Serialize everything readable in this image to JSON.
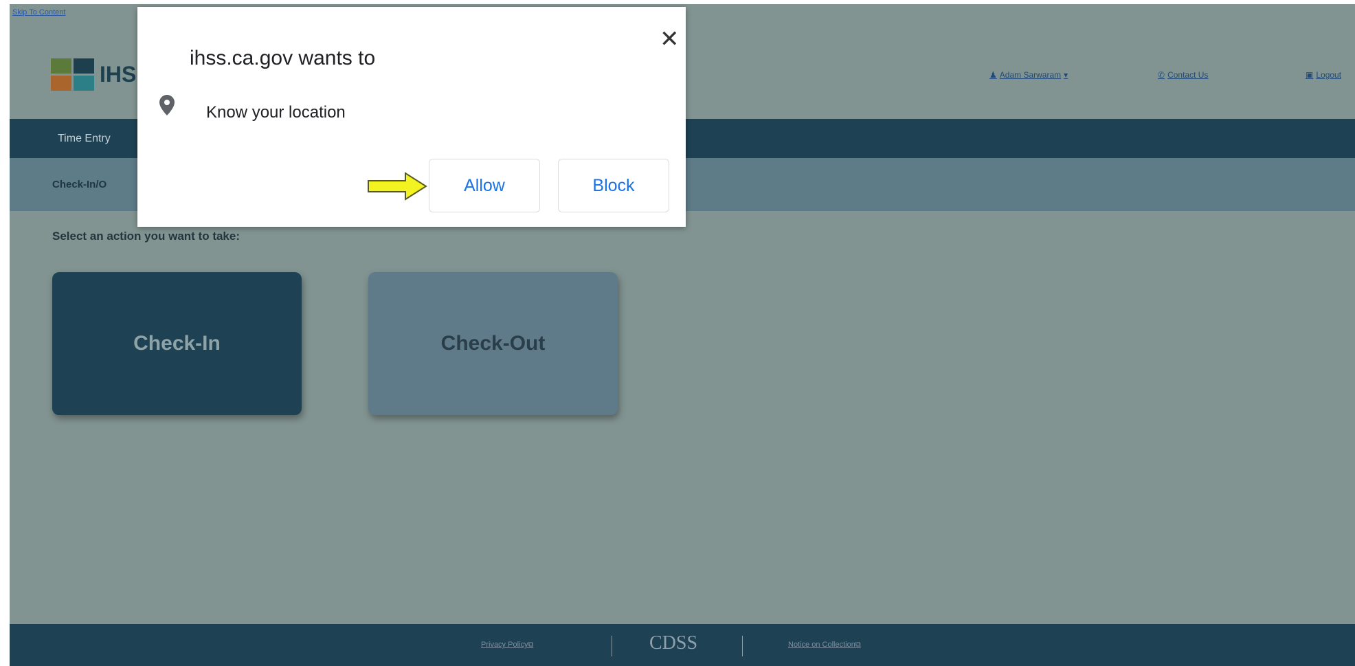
{
  "skip_link": "Skip To Content",
  "header": {
    "logo_text": "IHS",
    "user_menu": "Adam Sarwaram",
    "contact": "Contact Us",
    "logout": "Logout"
  },
  "nav": {
    "item": "Time Entry"
  },
  "subheader": {
    "title": "Check-In/O"
  },
  "main": {
    "prompt": "Select an action you want to take:",
    "checkin_label": "Check-In",
    "checkout_label": "Check-Out"
  },
  "footer": {
    "privacy": "Privacy Policy",
    "logo": "CDSS",
    "notice": "Notice on Collection"
  },
  "popup": {
    "title": "ihss.ca.gov  wants to",
    "permission": "Know your location",
    "allow": "Allow",
    "block": "Block"
  },
  "colors": {
    "overlay": "#829491",
    "navbar": "#1e4153",
    "checkin_bg": "#1e4153",
    "checkout_bg": "#5f7a88",
    "popup_button_text": "#1a73e8",
    "arrow": "#f3f322"
  }
}
